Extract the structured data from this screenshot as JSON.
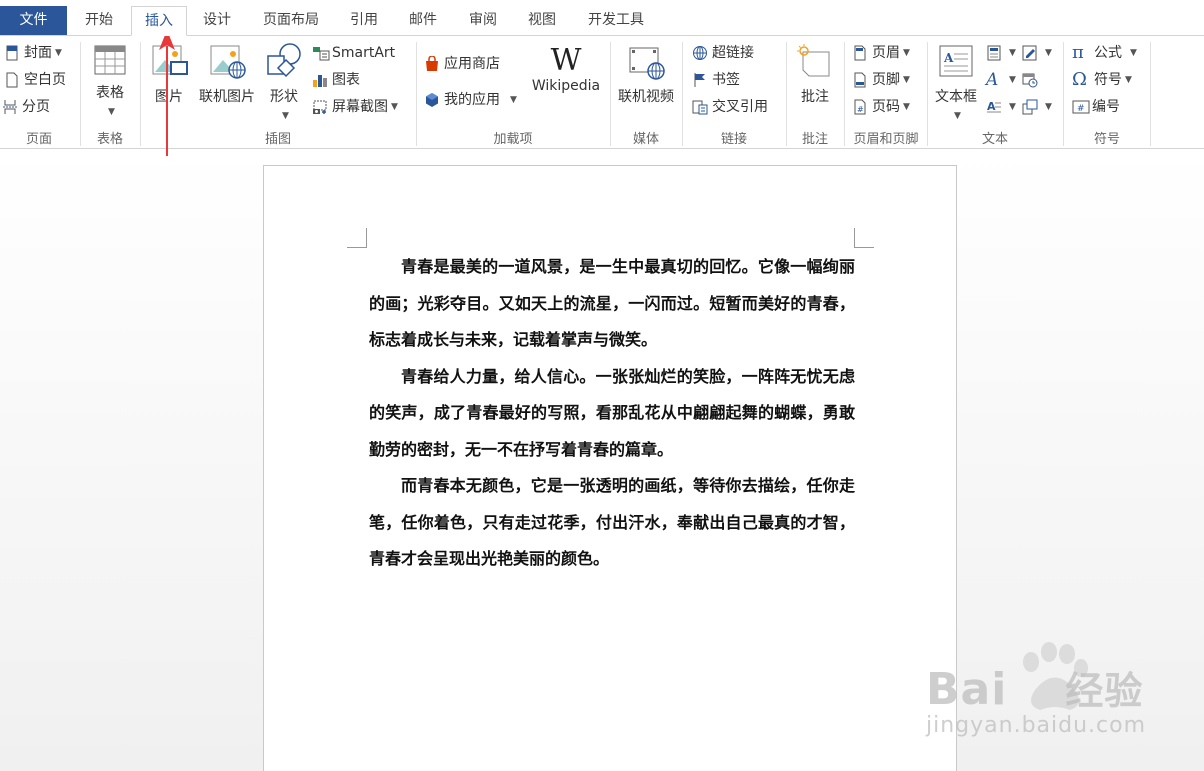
{
  "tabs": {
    "file": "文件",
    "home": "开始",
    "insert": "插入",
    "design": "设计",
    "layout": "页面布局",
    "references": "引用",
    "mailings": "邮件",
    "review": "审阅",
    "view": "视图",
    "developer": "开发工具"
  },
  "ribbon": {
    "pages": {
      "cover": "封面",
      "blank": "空白页",
      "break": "分页",
      "label": "页面"
    },
    "tables": {
      "table": "表格",
      "label": "表格"
    },
    "illustrations": {
      "picture": "图片",
      "online_picture": "联机图片",
      "shapes": "形状",
      "smartart": "SmartArt",
      "chart": "图表",
      "screenshot": "屏幕截图",
      "label": "插图"
    },
    "addins": {
      "store": "应用商店",
      "my_apps": "我的应用",
      "wikipedia": "Wikipedia",
      "label": "加载项"
    },
    "media": {
      "online_video": "联机视频",
      "label": "媒体"
    },
    "links": {
      "hyperlink": "超链接",
      "bookmark": "书签",
      "cross_ref": "交叉引用",
      "label": "链接"
    },
    "comments": {
      "comment": "批注",
      "label": "批注"
    },
    "header_footer": {
      "header": "页眉",
      "footer": "页脚",
      "page_number": "页码",
      "label": "页眉和页脚"
    },
    "text": {
      "textbox": "文本框",
      "label": "文本"
    },
    "symbols": {
      "equation": "公式",
      "symbol": "符号",
      "number": "编号",
      "label": "符号"
    }
  },
  "document": {
    "lines": [
      "青春是最美的一道风景，是一生中最真切的回忆。它像一幅",
      "绚丽的画；光彩夺目。又如天上的流星，一闪而过。短暂而美好",
      "的青春，标志着成长与未来，记载着掌声与微笑。",
      "青春给人力量，给人信心。一张张灿烂的笑脸，一阵阵无忧",
      "无虑的笑声，成了青春最好的写照，看那乱花从中翩翩起舞的蝴",
      "蝶，勇敢勤劳的密封，无一不在抒写着青春的篇章。",
      "而青春本无颜色，它是一张透明的画纸，等待你去描绘，任",
      "你走笔，任你着色，只有走过花季，付出汗水，奉献出自己最真",
      "的才智，青春才会呈现出光艳美丽的颜色。"
    ]
  },
  "watermark": {
    "brand": "Bai",
    "brand_cn": "经验",
    "site": "jingyan.baidu.com"
  },
  "colors": {
    "accent": "#2b579a",
    "arrow": "#e8393a"
  }
}
